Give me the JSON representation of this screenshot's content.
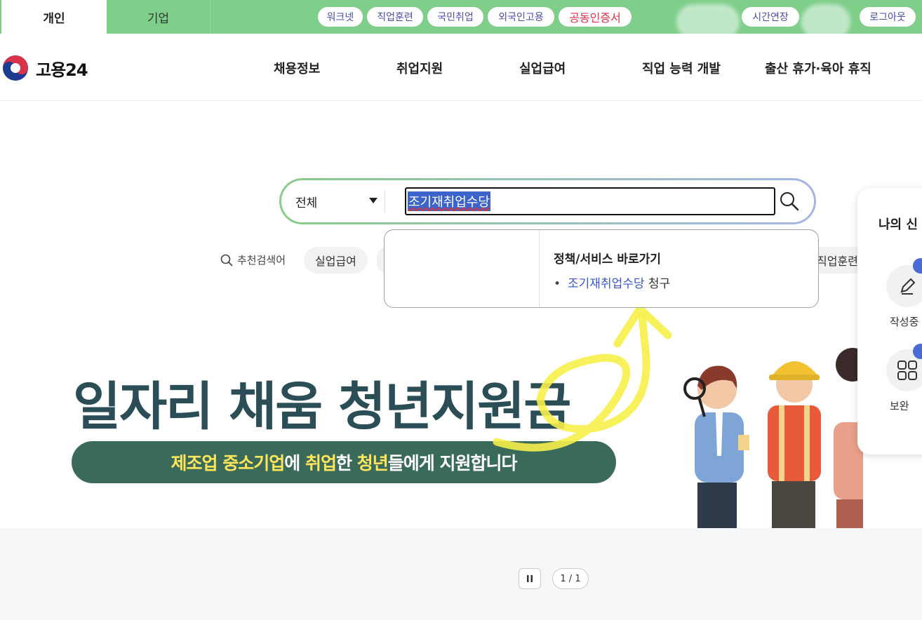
{
  "topbar": {
    "tabs": [
      "개인",
      "기업"
    ],
    "links": [
      "워크넷",
      "직업훈련",
      "국민취업",
      "외국인고용"
    ],
    "certificate": "공동인증서",
    "time_extend": "시간연장",
    "logout": "로그아웃"
  },
  "header": {
    "logo_text": "고용24",
    "nav": [
      "채용정보",
      "취업지원",
      "실업급여",
      "직업 능력 개발",
      "출산 휴가·육아 휴직"
    ]
  },
  "search": {
    "scope": "전체",
    "query": "조기재취업수당"
  },
  "recommended": {
    "label": "추천검색어",
    "chips": [
      "실업급여",
      "직업훈련"
    ]
  },
  "autocomplete": {
    "section_title": "정책/서비스 바로가기",
    "bullet": "•",
    "item_keyword": "조기재취업수당",
    "item_suffix": " 청구"
  },
  "banner": {
    "title": "일자리 채움 청년지원금",
    "subtitle_parts": [
      {
        "text": "제조업 중소기업",
        "hl": true
      },
      {
        "text": "에 ",
        "hl": false
      },
      {
        "text": "취업",
        "hl": true
      },
      {
        "text": "한 ",
        "hl": false
      },
      {
        "text": "청년",
        "hl": true
      },
      {
        "text": "들에게 지원합니다",
        "hl": false
      }
    ]
  },
  "carousel": {
    "page": "1 / 1"
  },
  "side_panel": {
    "title": "나의 신",
    "items": [
      "작성중",
      "보완"
    ]
  },
  "colors": {
    "topbar_green": "#7fce8a",
    "accent_blue": "#3a56c8",
    "banner_green": "#3a6a5a",
    "highlight_yellow": "#ffe55a"
  }
}
